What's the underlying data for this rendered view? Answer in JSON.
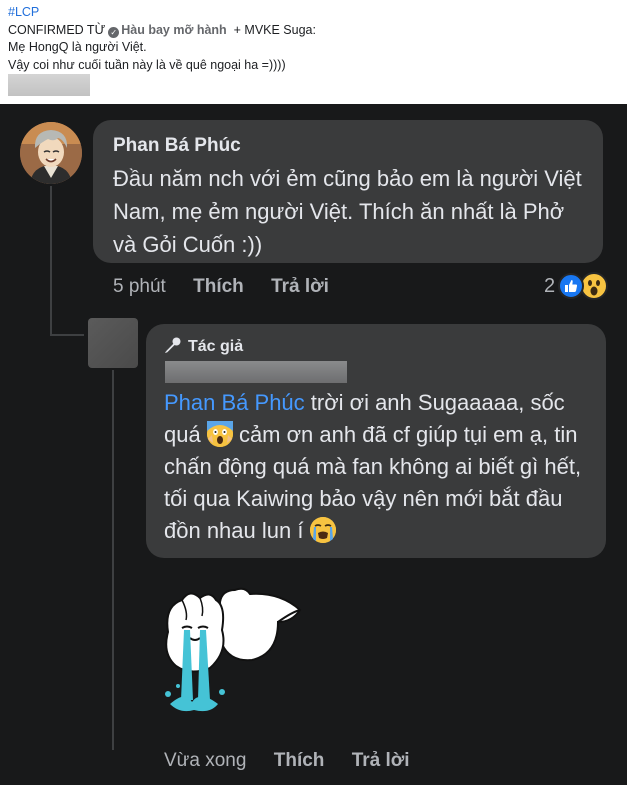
{
  "post": {
    "hashtag": "#LCP",
    "line1_prefix": "CONFIRMED TỪ",
    "page_name": "Hàu bay mỡ hành",
    "line1_suffix": "+ MVKE Suga:",
    "line2": "Mẹ HongQ là người Việt.",
    "line3": "Vậy coi như cuối tuần này là về quê ngoại ha =))))"
  },
  "comment": {
    "author": "Phan Bá Phúc",
    "text": "Đầu năm nch với ẻm cũng bảo em là người Việt Nam, mẹ ẻm người Việt. Thích ăn nhất là Phở và Gỏi Cuốn :))",
    "time": "5 phút",
    "like_label": "Thích",
    "reply_label": "Trả lời",
    "reaction_count": "2",
    "reaction_icons": [
      "like-icon",
      "wow-icon"
    ]
  },
  "reply": {
    "badge_label": "Tác giả",
    "badge_icon": "microphone-icon",
    "mention": "Phan Bá Phúc",
    "text_after_mention": " trời ơi anh Sugaaaaa, sốc quá ",
    "text_middle": " cảm ơn anh đã cf giúp tụi em ạ, tin chấn động quá mà fan không ai biết gì hết, tối qua Kaiwing bảo vậy nên mới bắt đầu đồn nhau lun í ",
    "emoji_1": "scream-emoji",
    "emoji_2": "crying-emoji",
    "sticker": "crying-bunny-sticker",
    "time": "Vừa xong",
    "like_label": "Thích",
    "reply_label": "Trả lời"
  },
  "colors": {
    "background_dark": "#18191a",
    "bubble": "#3a3b3c",
    "text_primary": "#e4e6eb",
    "text_secondary": "#b0b3b8",
    "mention": "#4599ff",
    "like_blue": "#1877f2",
    "hashtag": "#216fdb"
  }
}
